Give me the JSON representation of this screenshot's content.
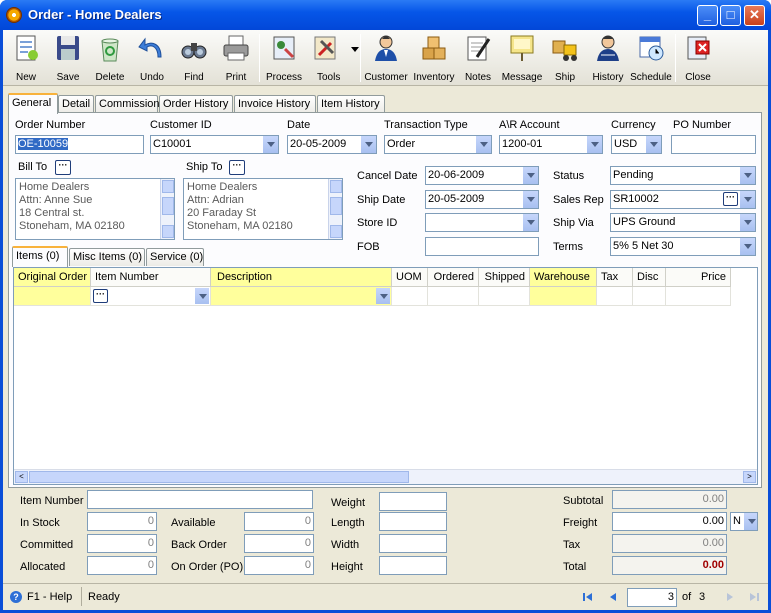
{
  "window": {
    "title": "Order - Home Dealers",
    "buttons": {
      "minimize": "_",
      "maximize": "□",
      "close": "✕"
    }
  },
  "toolbar": [
    {
      "label": "New",
      "icon": "new-document-icon"
    },
    {
      "label": "Save",
      "icon": "floppy-disk-icon"
    },
    {
      "label": "Delete",
      "icon": "recycle-bin-icon"
    },
    {
      "label": "Undo",
      "icon": "undo-arrow-icon"
    },
    {
      "label": "Find",
      "icon": "binoculars-icon"
    },
    {
      "label": "Print",
      "icon": "printer-icon"
    },
    {
      "label": "Process",
      "icon": "process-icon"
    },
    {
      "label": "Tools",
      "icon": "tools-icon"
    },
    {
      "label": "Customer",
      "icon": "person-icon"
    },
    {
      "label": "Inventory",
      "icon": "boxes-icon"
    },
    {
      "label": "Notes",
      "icon": "notepad-pen-icon"
    },
    {
      "label": "Message",
      "icon": "message-board-icon"
    },
    {
      "label": "Ship",
      "icon": "forklift-icon"
    },
    {
      "label": "History",
      "icon": "history-person-icon"
    },
    {
      "label": "Schedule",
      "icon": "calendar-clock-icon"
    },
    {
      "label": "Close",
      "icon": "close-door-icon"
    }
  ],
  "tabs": [
    "General",
    "Detail",
    "Commission",
    "Order History",
    "Invoice History",
    "Item History"
  ],
  "header": {
    "order_number_label": "Order Number",
    "order_number": "OE-10059",
    "customer_id_label": "Customer ID",
    "customer_id": "C10001",
    "date_label": "Date",
    "date": "20-05-2009",
    "transaction_type_label": "Transaction Type",
    "transaction_type": "Order",
    "ar_account_label": "A\\R Account",
    "ar_account": "1200-01",
    "currency_label": "Currency",
    "currency": "USD",
    "po_number_label": "PO Number",
    "po_number": ""
  },
  "bill_to": {
    "label": "Bill To",
    "ellipsis": "···",
    "lines": [
      "Home Dealers",
      "Attn: Anne Sue",
      "18 Central st.",
      "Stoneham, MA 02180"
    ]
  },
  "ship_to": {
    "label": "Ship To",
    "ellipsis": "···",
    "lines": [
      "Home Dealers",
      "Attn: Adrian",
      "20 Faraday St",
      "Stoneham, MA 02180"
    ]
  },
  "details": {
    "cancel_date_label": "Cancel Date",
    "cancel_date": "20-06-2009",
    "ship_date_label": "Ship Date",
    "ship_date": "20-05-2009",
    "store_id_label": "Store ID",
    "store_id": "",
    "fob_label": "FOB",
    "fob": "",
    "status_label": "Status",
    "status": "Pending",
    "sales_rep_label": "Sales Rep",
    "sales_rep": "SR10002",
    "ship_via_label": "Ship Via",
    "ship_via": "UPS Ground",
    "terms_label": "Terms",
    "terms": "5% 5 Net 30"
  },
  "subtabs": [
    "Items (0)",
    "Misc Items (0)",
    "Service (0)"
  ],
  "grid": {
    "columns": [
      "Original Order",
      "Item Number",
      "Description",
      "UOM",
      "Ordered",
      "Shipped",
      "Warehouse",
      "Tax",
      "Disc",
      "Price"
    ]
  },
  "footer": {
    "item_number_label": "Item Number",
    "item_number": "",
    "in_stock_label": "In Stock",
    "in_stock": "0",
    "committed_label": "Committed",
    "committed": "0",
    "allocated_label": "Allocated",
    "allocated": "0",
    "available_label": "Available",
    "available": "0",
    "back_order_label": "Back Order",
    "back_order": "0",
    "on_order_label": "On Order (PO)",
    "on_order": "0",
    "weight_label": "Weight",
    "length_label": "Length",
    "width_label": "Width",
    "height_label": "Height",
    "subtotal_label": "Subtotal",
    "subtotal": "0.00",
    "freight_label": "Freight",
    "freight": "0.00",
    "freight_flag": "N",
    "tax_label": "Tax",
    "tax": "0.00",
    "total_label": "Total",
    "total": "0.00"
  },
  "status": {
    "help": "F1 - Help",
    "text": "Ready",
    "page": "3",
    "of_label": "of",
    "page_count": "3"
  }
}
